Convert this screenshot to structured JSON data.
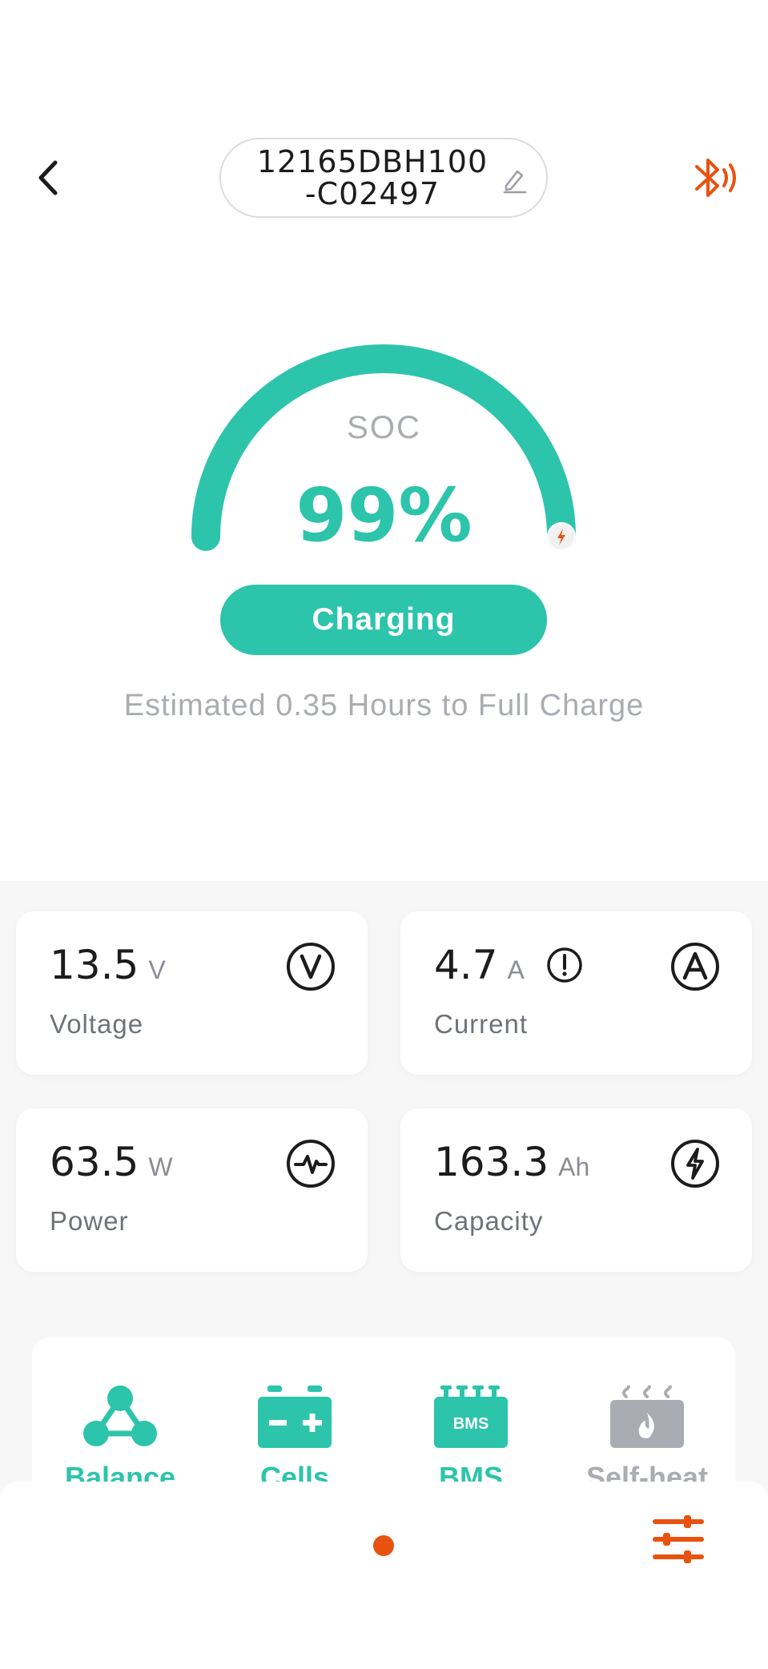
{
  "header": {
    "device_name_line1": "12165DBH100",
    "device_name_line2": "-C02497"
  },
  "gauge": {
    "label": "SOC",
    "value_text": "99%",
    "level_percent": 99,
    "status": "Charging",
    "estimate": "Estimated 0.35 Hours to Full Charge"
  },
  "metrics": [
    {
      "value": "13.5",
      "unit": "V",
      "label": "Voltage",
      "icon": "voltage-icon"
    },
    {
      "value": "4.7",
      "unit": "A",
      "label": "Current",
      "icon": "ampere-icon"
    },
    {
      "value": "63.5",
      "unit": "W",
      "label": "Power",
      "icon": "pulse-icon"
    },
    {
      "value": "163.3",
      "unit": "Ah",
      "label": "Capacity",
      "icon": "bolt-icon"
    }
  ],
  "tools": [
    {
      "label": "Balance",
      "icon": "balance-icon"
    },
    {
      "label": "Cells",
      "icon": "battery-cells-icon"
    },
    {
      "label": "BMS",
      "icon": "bms-chip-icon",
      "badge": "BMS"
    },
    {
      "label": "Self-heat",
      "icon": "self-heat-icon"
    }
  ],
  "colors": {
    "accent": "#2cc4ab",
    "brand_orange": "#e8520f",
    "muted": "#a9acb2"
  }
}
